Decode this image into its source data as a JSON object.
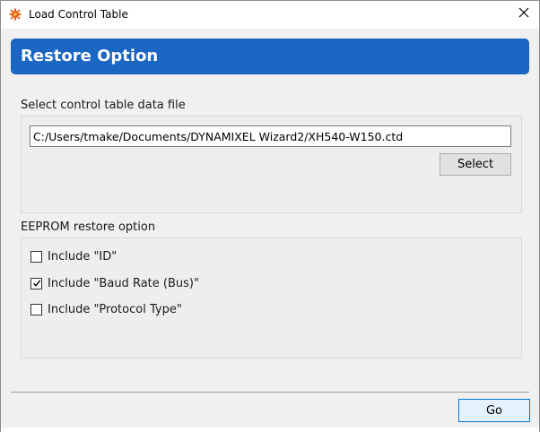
{
  "window": {
    "title": "Load Control Table",
    "close_glyph": "✕"
  },
  "header": {
    "title": "Restore Option"
  },
  "file_section": {
    "label": "Select control table data file",
    "path_value": "C:/Users/tmake/Documents/DYNAMIXEL Wizard2/XH540-W150.ctd",
    "select_label": "Select"
  },
  "eeprom_section": {
    "label": "EEPROM restore option",
    "options": [
      {
        "label": "Include \"ID\"",
        "checked": false
      },
      {
        "label": "Include \"Baud Rate (Bus)\"",
        "checked": true
      },
      {
        "label": "Include \"Protocol Type\"",
        "checked": false
      }
    ]
  },
  "footer": {
    "go_label": "Go"
  },
  "colors": {
    "header_bg": "#1a66c2",
    "app_icon": "#e8601c"
  },
  "icons": {
    "app": "dynamixel-gear-icon",
    "close": "close-icon",
    "check": "checkmark-icon"
  }
}
